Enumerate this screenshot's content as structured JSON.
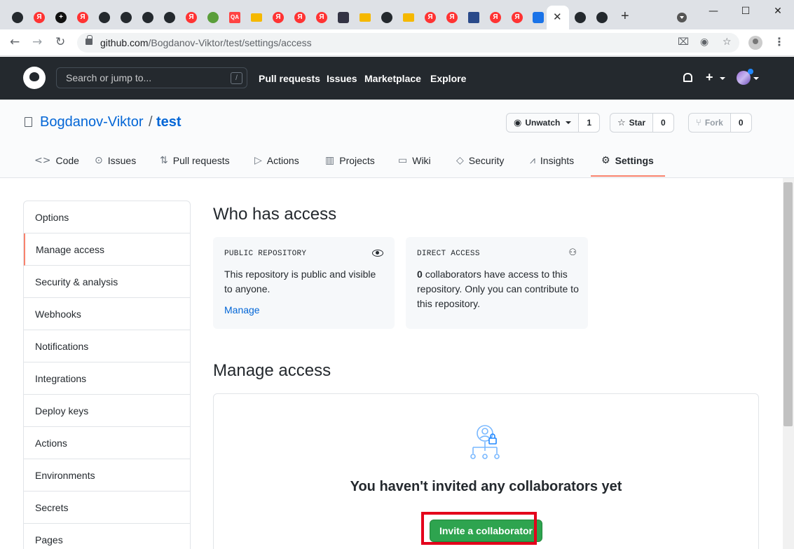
{
  "browser": {
    "tabs": [
      {
        "favicon": "github-icon",
        "kind": "gh",
        "glyph": ""
      },
      {
        "favicon": "yandex-icon",
        "kind": "ya",
        "glyph": "Я"
      },
      {
        "favicon": "plus-icon",
        "kind": "plus",
        "glyph": "+"
      },
      {
        "favicon": "yandex-icon",
        "kind": "ya",
        "glyph": "Я"
      },
      {
        "favicon": "github-icon",
        "kind": "gh",
        "glyph": ""
      },
      {
        "favicon": "github-icon",
        "kind": "gh",
        "glyph": ""
      },
      {
        "favicon": "github-icon",
        "kind": "gh",
        "glyph": ""
      },
      {
        "favicon": "github-icon",
        "kind": "gh",
        "glyph": ""
      },
      {
        "favicon": "yandex-icon",
        "kind": "ya",
        "glyph": "Я"
      },
      {
        "favicon": "globe-icon",
        "kind": "globe",
        "glyph": ""
      },
      {
        "favicon": "qa-icon",
        "kind": "qa",
        "glyph": "QA"
      },
      {
        "favicon": "mail-icon",
        "kind": "mail",
        "glyph": ""
      },
      {
        "favicon": "yandex-icon",
        "kind": "ya",
        "glyph": "Я"
      },
      {
        "favicon": "yandex-icon",
        "kind": "ya",
        "glyph": "Я"
      },
      {
        "favicon": "yandex-icon",
        "kind": "ya",
        "glyph": "Я"
      },
      {
        "favicon": "app-icon",
        "kind": "sq",
        "glyph": ""
      },
      {
        "favicon": "mail-icon",
        "kind": "mail",
        "glyph": ""
      },
      {
        "favicon": "github-icon",
        "kind": "gh",
        "glyph": ""
      },
      {
        "favicon": "mail-icon",
        "kind": "mail",
        "glyph": ""
      },
      {
        "favicon": "yandex-icon",
        "kind": "ya",
        "glyph": "Я"
      },
      {
        "favicon": "yandex-icon",
        "kind": "ya",
        "glyph": "Я"
      },
      {
        "favicon": "document-icon",
        "kind": "doc",
        "glyph": ""
      },
      {
        "favicon": "yandex-icon",
        "kind": "ya",
        "glyph": "Я"
      },
      {
        "favicon": "yandex-icon",
        "kind": "ya",
        "glyph": "Я"
      },
      {
        "favicon": "chat-icon",
        "kind": "chat",
        "glyph": ""
      },
      {
        "favicon": "github-icon",
        "kind": "gh",
        "glyph": ""
      },
      {
        "favicon": "github-icon",
        "kind": "gh",
        "glyph": ""
      },
      {
        "favicon": "github-icon",
        "kind": "gh",
        "glyph": ""
      }
    ],
    "url_host": "github.com",
    "url_path": "/Bogdanov-Viktor/test/settings/access"
  },
  "github": {
    "search_placeholder": "Search or jump to...",
    "search_key": "/",
    "nav": [
      "Pull requests",
      "Issues",
      "Marketplace",
      "Explore"
    ]
  },
  "repo": {
    "owner": "Bogdanov-Viktor",
    "separator": "/",
    "name": "test",
    "unwatch_label": "Unwatch",
    "watch_count": "1",
    "star_label": "Star",
    "star_count": "0",
    "fork_label": "Fork",
    "fork_count": "0",
    "tabs": [
      {
        "label": "Code",
        "icon": "code-icon",
        "glyph": "<>"
      },
      {
        "label": "Issues",
        "icon": "issue-icon",
        "glyph": "⊙"
      },
      {
        "label": "Pull requests",
        "icon": "pull-request-icon",
        "glyph": "⇅"
      },
      {
        "label": "Actions",
        "icon": "play-icon",
        "glyph": "▷"
      },
      {
        "label": "Projects",
        "icon": "project-icon",
        "glyph": "▥"
      },
      {
        "label": "Wiki",
        "icon": "book-icon",
        "glyph": "▭"
      },
      {
        "label": "Security",
        "icon": "shield-icon",
        "glyph": "◇"
      },
      {
        "label": "Insights",
        "icon": "graph-icon",
        "glyph": "⩘"
      },
      {
        "label": "Settings",
        "icon": "gear-icon",
        "glyph": "⚙"
      }
    ],
    "active_tab": "Settings"
  },
  "sidebar": {
    "items": [
      "Options",
      "Manage access",
      "Security & analysis",
      "Webhooks",
      "Notifications",
      "Integrations",
      "Deploy keys",
      "Actions",
      "Environments",
      "Secrets",
      "Pages"
    ],
    "selected": "Manage access"
  },
  "access": {
    "heading": "Who has access",
    "public_card": {
      "label": "PUBLIC REPOSITORY",
      "text": "This repository is public and visible to anyone.",
      "link": "Manage"
    },
    "direct_card": {
      "label": "DIRECT ACCESS",
      "count": "0",
      "text": "collaborators have access to this repository. Only you can contribute to this repository."
    }
  },
  "manage": {
    "heading": "Manage access",
    "empty_title": "You haven't invited any collaborators yet",
    "invite_label": "Invite a collaborator"
  },
  "colors": {
    "accent_link": "#0366d6",
    "active_tab_underline": "#f9826c",
    "primary_button": "#2ea44f",
    "highlight": "#e4001b",
    "header_bg": "#24292e"
  }
}
